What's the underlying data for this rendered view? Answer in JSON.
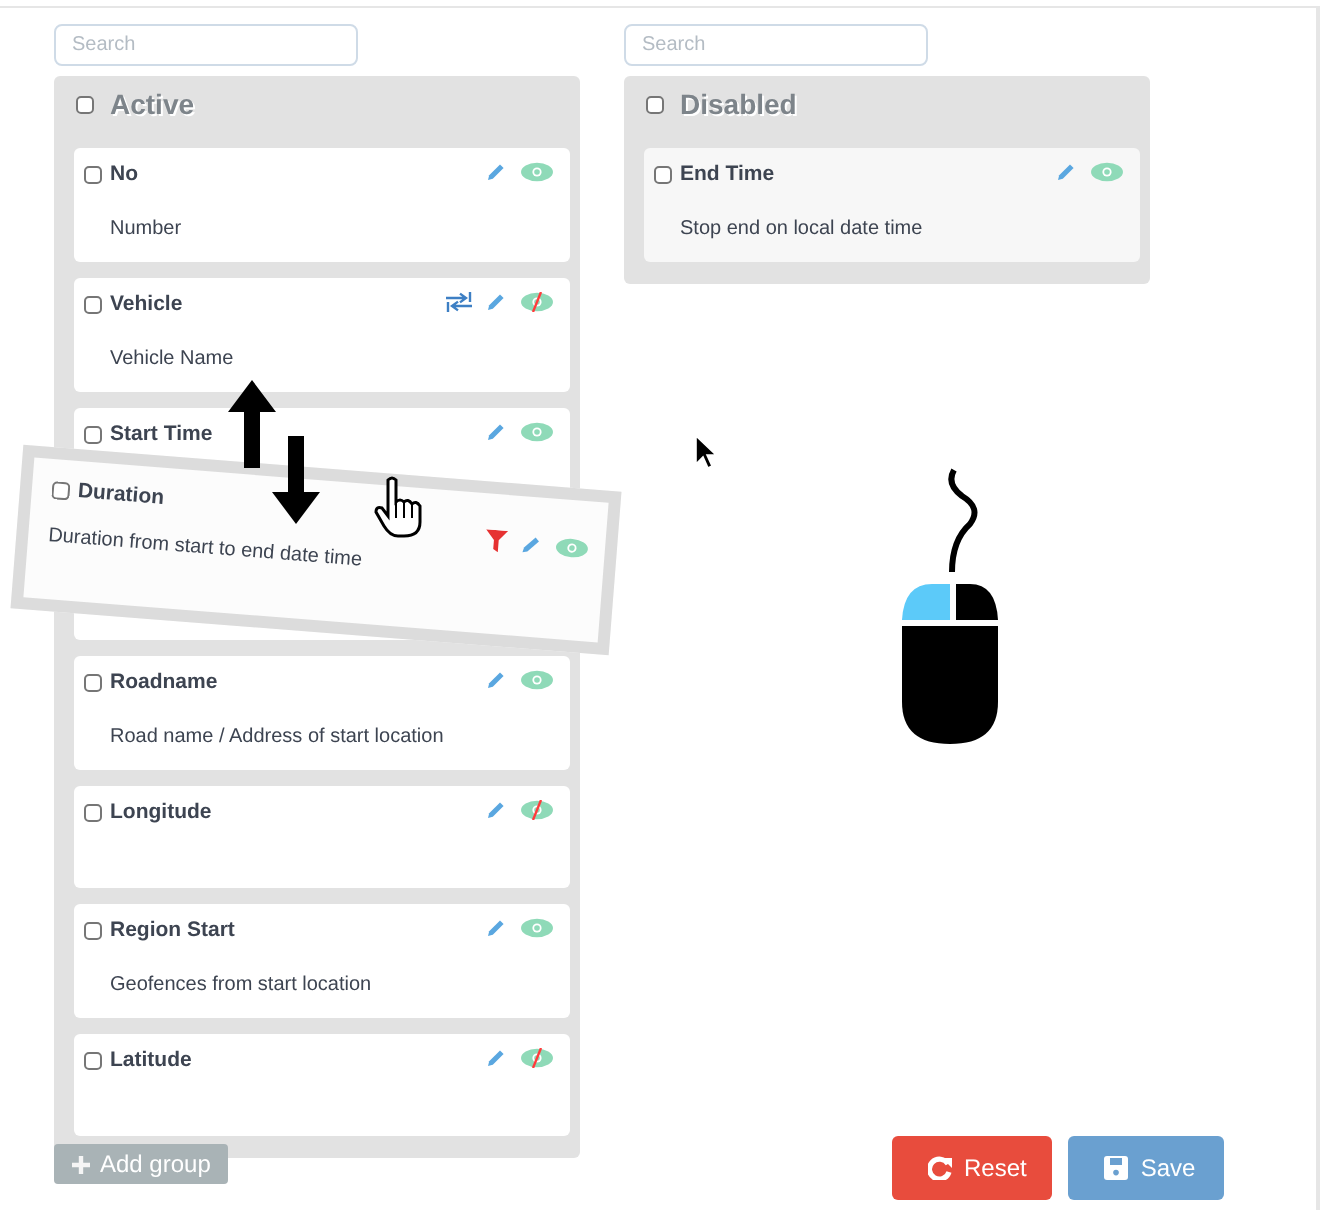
{
  "groups": [
    {
      "title": "Active",
      "checked": false,
      "search": {
        "placeholder": "Search"
      },
      "items": [
        {
          "kind": "field",
          "name": "No",
          "description": "Number",
          "checked": false,
          "visible": true,
          "linked": false
        },
        {
          "kind": "field",
          "name": "Vehicle",
          "description": "Vehicle Name",
          "checked": false,
          "visible": false,
          "linked": true
        },
        {
          "kind": "field",
          "name": "Start Time",
          "checked": false,
          "visible": true,
          "linked": false
        },
        {
          "kind": "placeholder"
        },
        {
          "kind": "field",
          "name": "Roadname",
          "description": "Road name / Address of start location",
          "checked": false,
          "visible": true,
          "linked": false
        },
        {
          "kind": "field",
          "name": "Longitude",
          "checked": false,
          "visible": false,
          "linked": false
        },
        {
          "kind": "field",
          "name": "Region Start",
          "description": "Geofences from start location",
          "checked": false,
          "visible": true,
          "linked": false
        },
        {
          "kind": "field",
          "name": "Latitude",
          "checked": false,
          "visible": false,
          "linked": false
        }
      ]
    },
    {
      "title": "Disabled",
      "checked": false,
      "search": {
        "placeholder": "Search"
      },
      "items": [
        {
          "kind": "field",
          "name": "End Time",
          "description": "Stop end on local date time",
          "checked": false,
          "visible": true,
          "linked": false
        }
      ]
    }
  ],
  "dragging": {
    "name": "Duration",
    "description": "Duration from start to end date time",
    "checked": false,
    "visible": true,
    "filtered": true
  },
  "add_group": {
    "label": "Add group",
    "disabled": true
  },
  "buttons": [
    {
      "kind": "reset",
      "label": "Reset"
    },
    {
      "kind": "save",
      "label": "Save"
    }
  ]
}
